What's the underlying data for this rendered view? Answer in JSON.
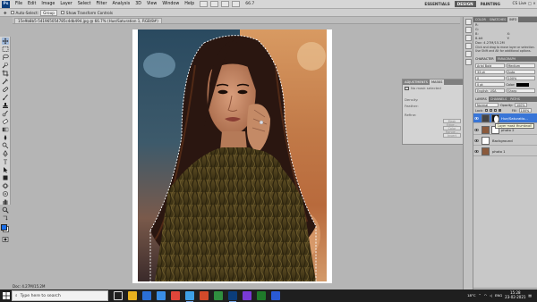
{
  "menubar": {
    "logo": "Ps",
    "items": [
      "File",
      "Edit",
      "Image",
      "Layer",
      "Select",
      "Filter",
      "Analysis",
      "3D",
      "View",
      "Window",
      "Help"
    ],
    "zoom": "66.7",
    "workspaces": [
      "ESSENTIALS",
      "DESIGN",
      "PAINTING"
    ],
    "active_workspace": "DESIGN",
    "cs_live": "CS Live"
  },
  "options": {
    "auto_select_label": "Auto-Select:",
    "auto_select_value": "Group",
    "transform_label": "Show Transform Controls"
  },
  "document": {
    "tab_label": "15e9b8b5-541965054785c4db494.jpg @ 66.7% (Hue/Saturation 1, RGB/8#)",
    "status": "Doc: 4.27M/15.2M"
  },
  "float_panel": {
    "tabs": [
      "ADJUSTMENTS",
      "MASKS"
    ],
    "active_tab": "MASKS",
    "no_mask": "No mask selected",
    "rows": [
      "Density:",
      "Feather:",
      "Refine:"
    ],
    "buttons": [
      "Mask Edge...",
      "Color Range...",
      "Invert"
    ]
  },
  "right": {
    "top_tabs": [
      "COLOR",
      "SWATCHES",
      "INFO"
    ],
    "active_top": "INFO",
    "info_lines": [
      "R:",
      "G:",
      "B:",
      "8-bit",
      "X:",
      "Y:",
      "Doc: 4.27M/15.2M",
      "Click and drag to move layer or selection.",
      "Use Shift and Alt for additional options."
    ],
    "char_tabs": [
      "CHARACTER",
      "PARAGRAPH"
    ],
    "active_char": "CHARACTER",
    "font_family": "Arial Bold",
    "font_style": "Medium",
    "font_size": "33 pt",
    "leading": "Auto",
    "tracking": "0",
    "scale": "100%",
    "baseline": "0 pt",
    "color_label": "Color:",
    "language": "English: USA",
    "aa": "Sharp",
    "layers_tabs": [
      "LAYERS",
      "CHANNELS",
      "PATHS"
    ],
    "active_layers": "LAYERS",
    "blend_mode": "Normal",
    "opacity_label": "Opacity:",
    "opacity": "100%",
    "lock_label": "Lock:",
    "fill_label": "Fill:",
    "fill": "100%",
    "layers": [
      {
        "name": "Hue/Saturatio...",
        "selected": true
      },
      {
        "name": "photo 2",
        "selected": false
      },
      {
        "name": "Background",
        "selected": false
      },
      {
        "name": "photo 1",
        "selected": false
      }
    ],
    "tooltip": "Layer mask thumbnail"
  },
  "taskbar": {
    "search_placeholder": "Type here to search",
    "time": "15:28",
    "date": "23-02-2021",
    "lang": "ENG",
    "temp": "18°C"
  },
  "colors": {
    "accent": "#3875d7",
    "menubar_bg": "#d6d6d6",
    "workspace_bg": "#b5b5b5",
    "taskbar_bg": "#1f1f1f"
  }
}
